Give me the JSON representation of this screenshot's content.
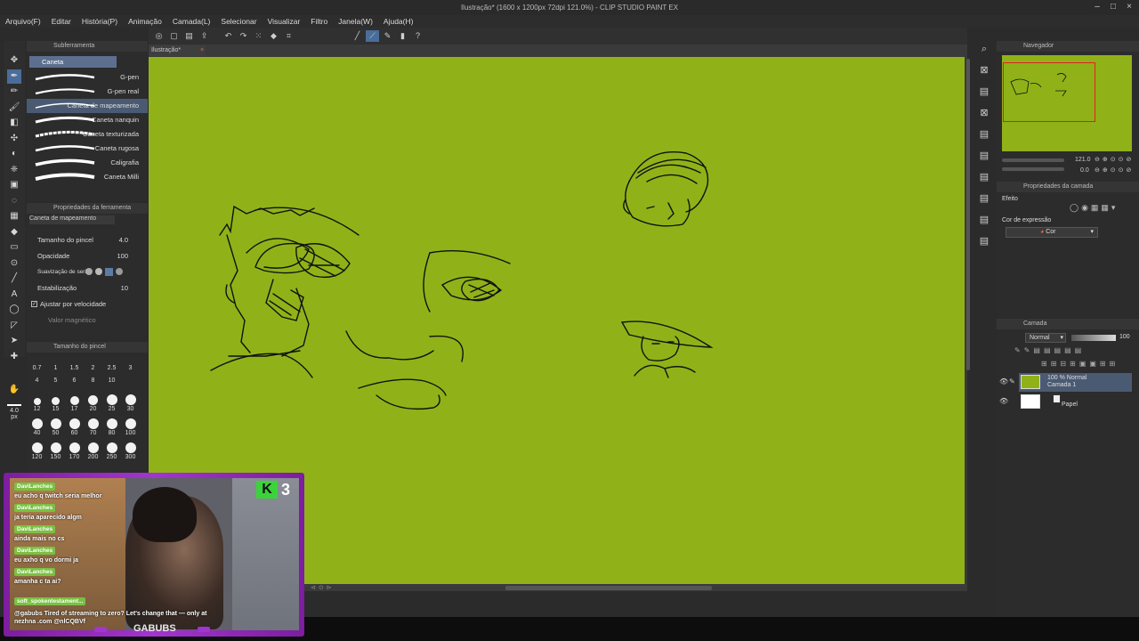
{
  "window": {
    "title": "Ilustração* (1600 x 1200px 72dpi 121.0%) - CLIP STUDIO PAINT EX"
  },
  "menu": [
    "Arquivo(F)",
    "Editar",
    "História(P)",
    "Animação",
    "Camada(L)",
    "Selecionar",
    "Visualizar",
    "Filtro",
    "Janela(W)",
    "Ajuda(H)"
  ],
  "subtool": {
    "panel_title": "Subferramenta",
    "group": "Caneta",
    "items": [
      "G-pen",
      "G-pen real",
      "Caneta de mapeamento",
      "Caneta nanquin",
      "Caneta texturizada",
      "Caneta rugosa",
      "Caligrafia",
      "Caneta Milli"
    ],
    "selected_index": 2
  },
  "tool_props": {
    "panel_title": "Propriedades da ferramenta",
    "tool_name": "Caneta de mapeamento",
    "brush_size_label": "Tamanho do pincel",
    "brush_size_value": "4.0",
    "opacity_label": "Opacidade",
    "opacity_value": "100",
    "stabilization_label": "Estabilização",
    "stabilization_value": "10",
    "smoothing_label": "Suavização de seri",
    "speed_label": "Ajustar por velocidade",
    "magnet_label": "Valor magnético"
  },
  "brush_size": {
    "panel_title": "Tamanho do pincel",
    "small_sizes": [
      "0.7",
      "1",
      "1.5",
      "2",
      "2.5",
      "3",
      "4",
      "5",
      "6",
      "8",
      "10"
    ],
    "dot_sizes": [
      "12",
      "15",
      "17",
      "20",
      "25",
      "30",
      "40",
      "50",
      "60",
      "70",
      "80",
      "100",
      "120",
      "150",
      "170",
      "200",
      "250",
      "300"
    ],
    "current_size": "4.0",
    "unit": "px"
  },
  "canvas": {
    "tab_label": "Ilustração*",
    "bg_color": "#90b218"
  },
  "navigator": {
    "panel_title": "Navegador",
    "zoom": "121.0",
    "rotation": "0.0"
  },
  "layer_props": {
    "panel_title": "Propriedades da camada",
    "effect_label": "Efeito",
    "expression_color_label": "Cor de expressão",
    "expression_color_value": "Cor"
  },
  "layers": {
    "panel_title": "Camada",
    "blend_mode": "Normal",
    "opacity": "100",
    "items": [
      {
        "line1": "100 % Normal",
        "line2": "Camada 1"
      },
      {
        "line1": "",
        "line2": "Papel"
      }
    ]
  },
  "stream": {
    "channel": "GABUBS",
    "badge_letter": "K",
    "badge_count": "3",
    "chat": [
      {
        "user": "DaviLanches",
        "msg": "eu acho q twitch seria melhor"
      },
      {
        "user": "DaviLanches",
        "msg": "ja teria aparecido algm"
      },
      {
        "user": "DaviLanches",
        "msg": "ainda mais no cs"
      },
      {
        "user": "DaviLanches",
        "msg": "eu axho q vo dormi ja"
      },
      {
        "user": "DaviLanches",
        "msg": "amanha c ta ai?"
      }
    ],
    "promo_user": "soft_spokentestament...",
    "promo_msg": "@gabubs Tired of streaming to zero? Let's change that — only at nezhna .com @nlCQBVf"
  },
  "colors": {
    "accent": "#4a6d9a",
    "stream_frame": "#a235cf",
    "chat_badge": "#7ac142"
  }
}
